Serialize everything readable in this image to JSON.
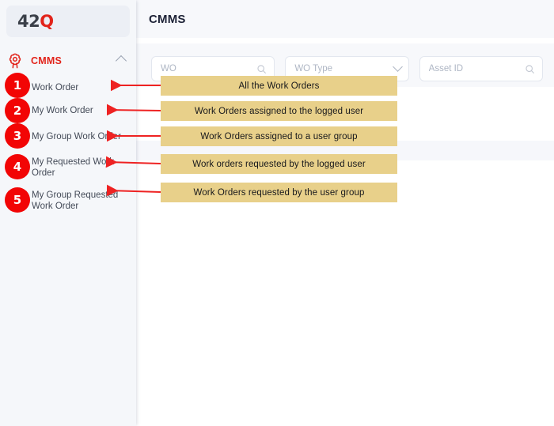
{
  "sidebar": {
    "logo": {
      "prefix": "42",
      "suffix": "Q",
      "name": "42Q"
    },
    "section": {
      "label": "CMMS",
      "icon": "gear-icon",
      "collapse_icon": "chevron-up-icon"
    },
    "items": [
      {
        "badge": "1",
        "label": "Work Order"
      },
      {
        "badge": "2",
        "label": "My Work Order"
      },
      {
        "badge": "3",
        "label": "My Group Work Order"
      },
      {
        "badge": "4",
        "label": "My Requested Work Order"
      },
      {
        "badge": "5",
        "label": "My Group Requested Work Order"
      }
    ]
  },
  "header": {
    "title": "CMMS"
  },
  "filters": {
    "wo": {
      "placeholder": "WO",
      "value": "",
      "icon": "search-icon"
    },
    "wo_type": {
      "placeholder": "WO Type",
      "value": "",
      "icon": "chevron-down-icon"
    },
    "asset_id": {
      "placeholder": "Asset ID",
      "value": "",
      "icon": "search-icon"
    }
  },
  "annotations": {
    "accent_color": "#e8d08a",
    "arrow_color": "#ee2222",
    "badge_color": "#f20505",
    "callouts": [
      {
        "n": "1",
        "text": "All the Work Orders"
      },
      {
        "n": "2",
        "text": "Work Orders assigned to the logged user"
      },
      {
        "n": "3",
        "text": "Work Orders assigned to a user group"
      },
      {
        "n": "4",
        "text": "Work orders requested by the logged user"
      },
      {
        "n": "5",
        "text": "Work Orders requested by the user group"
      }
    ]
  }
}
